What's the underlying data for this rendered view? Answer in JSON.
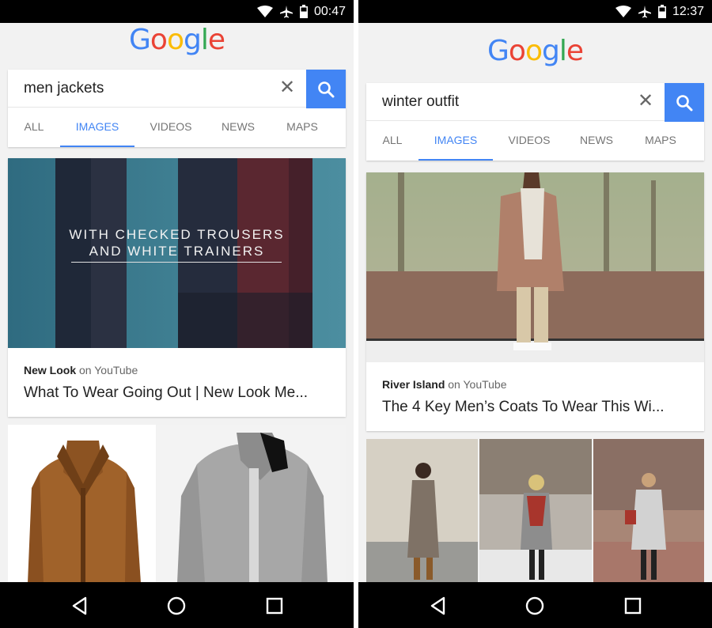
{
  "colors": {
    "google_blue": "#4285f4",
    "google_red": "#ea4335",
    "google_yellow": "#fbbc05",
    "google_green": "#34a853",
    "status_bar": "#000000",
    "nav_bar": "#000000"
  },
  "logo_letters": [
    "G",
    "o",
    "o",
    "g",
    "l",
    "e"
  ],
  "icons": {
    "wifi": "wifi-icon",
    "airplane": "airplane-icon",
    "battery": "battery-icon",
    "clear": "close-icon",
    "search": "search-icon",
    "back": "back-triangle-icon",
    "home": "home-circle-icon",
    "recents": "recents-square-icon"
  },
  "screens": [
    {
      "status_time": "00:47",
      "query": "men jackets",
      "clear_symbol": "✕",
      "tabs": [
        "ALL",
        "IMAGES",
        "VIDEOS",
        "NEWS",
        "MAPS"
      ],
      "active_tab": "IMAGES",
      "result": {
        "source": "New Look",
        "via": "on YouTube",
        "title": "What To Wear Going Out | New Look Me...",
        "overlay_line1": "WITH CHECKED TROUSERS",
        "overlay_line2": "AND WHITE TRAINERS"
      }
    },
    {
      "status_time": "12:37",
      "query": "winter outfit",
      "clear_symbol": "✕",
      "tabs": [
        "ALL",
        "IMAGES",
        "VIDEOS",
        "NEWS",
        "MAPS"
      ],
      "active_tab": "IMAGES",
      "result": {
        "source": "River Island",
        "via": "on YouTube",
        "title": "The 4 Key Men’s Coats To Wear This Wi..."
      }
    }
  ]
}
